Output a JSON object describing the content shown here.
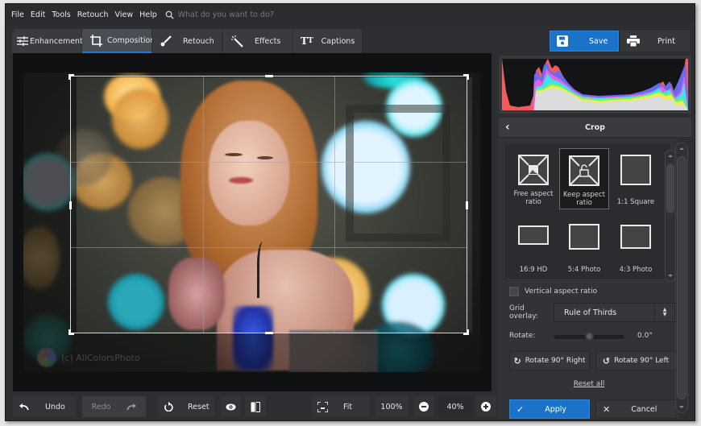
{
  "menubar": {
    "items": [
      "File",
      "Edit",
      "Tools",
      "Retouch",
      "View",
      "Help"
    ],
    "search_placeholder": "What do you want to do?"
  },
  "tabs": [
    {
      "label": "Enhancement",
      "icon": "sliders-icon",
      "active": false
    },
    {
      "label": "Composition",
      "icon": "crop-icon",
      "active": true
    },
    {
      "label": "Retouch",
      "icon": "brush-icon",
      "active": false
    },
    {
      "label": "Effects",
      "icon": "magic-wand-icon",
      "active": false
    },
    {
      "label": "Captions",
      "icon": "text-icon",
      "active": false
    }
  ],
  "actions": {
    "save_label": "Save",
    "print_label": "Print"
  },
  "canvas": {
    "watermark": "(c) AllColorsPhoto"
  },
  "bottombar": {
    "undo_label": "Undo",
    "redo_label": "Redo",
    "reset_label": "Reset",
    "fit_label": "Fit",
    "zoom_100_label": "100%",
    "zoom_value": "40%"
  },
  "panel": {
    "title": "Crop",
    "presets": [
      {
        "label": "Free aspect ratio",
        "icon": "free-aspect-icon",
        "selected": false
      },
      {
        "label": "Keep aspect ratio",
        "icon": "keep-aspect-lock-icon",
        "selected": true
      },
      {
        "label": "1:1 Square",
        "icon": "square-icon",
        "selected": false
      },
      {
        "label": "16:9 HD",
        "icon": "hd-ratio-icon",
        "selected": false
      },
      {
        "label": "5:4 Photo",
        "icon": "photo-54-icon",
        "selected": false
      },
      {
        "label": "4:3 Photo",
        "icon": "photo-43-icon",
        "selected": false
      }
    ],
    "vertical_aspect_label": "Vertical aspect ratio",
    "vertical_aspect_checked": false,
    "grid_overlay_label": "Grid overlay:",
    "grid_overlay_value": "Rule of Thirds",
    "rotate_label": "Rotate:",
    "rotate_value": "0.0°",
    "rotate_slider_fraction": 0.5,
    "rotate_right_label": "Rotate 90° Right",
    "rotate_left_label": "Rotate 90° Left",
    "reset_all_label": "Reset all",
    "apply_label": "Apply",
    "cancel_label": "Cancel"
  },
  "colors": {
    "accent": "#1a73c9",
    "background": "#2d2e31"
  }
}
